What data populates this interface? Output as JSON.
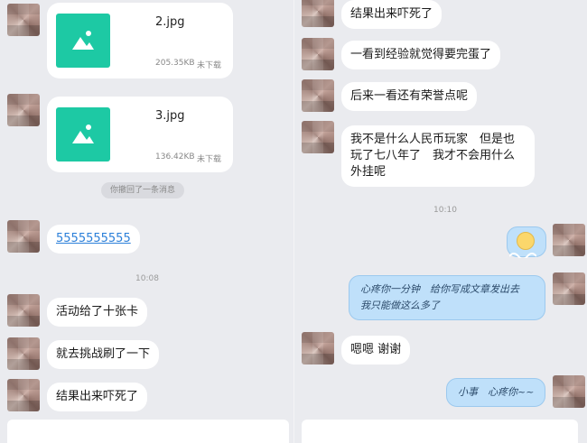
{
  "left": {
    "files": [
      {
        "name": "2.jpg",
        "size": "205.35KB",
        "status": "未下载"
      },
      {
        "name": "3.jpg",
        "size": "136.42KB",
        "status": "未下载"
      }
    ],
    "recall_notice": "你撤回了一条消息",
    "link_message": "5555555555",
    "time_1": "10:08",
    "messages": [
      "活动给了十张卡",
      "就去挑战刷了一下",
      "结果出来吓死了"
    ]
  },
  "right": {
    "messages": [
      "结果出来吓死了",
      "一看到经验就觉得要完蛋了",
      "后来一看还有荣誉点呢",
      "我不是什么人民币玩家　但是也玩了七八年了　我才不会用什么外挂呢"
    ],
    "time_1": "10:10",
    "self_messages": [
      "心疼你一分钟　给你写成文章发出去　我只能做这么多了",
      "小事　心疼你~~"
    ],
    "reply": "嗯嗯 谢谢"
  },
  "colors": {
    "file_thumb": "#1dc9a4",
    "link": "#2b7fd9",
    "self_bubble": "#bfe0fa",
    "background": "#eaebef"
  }
}
